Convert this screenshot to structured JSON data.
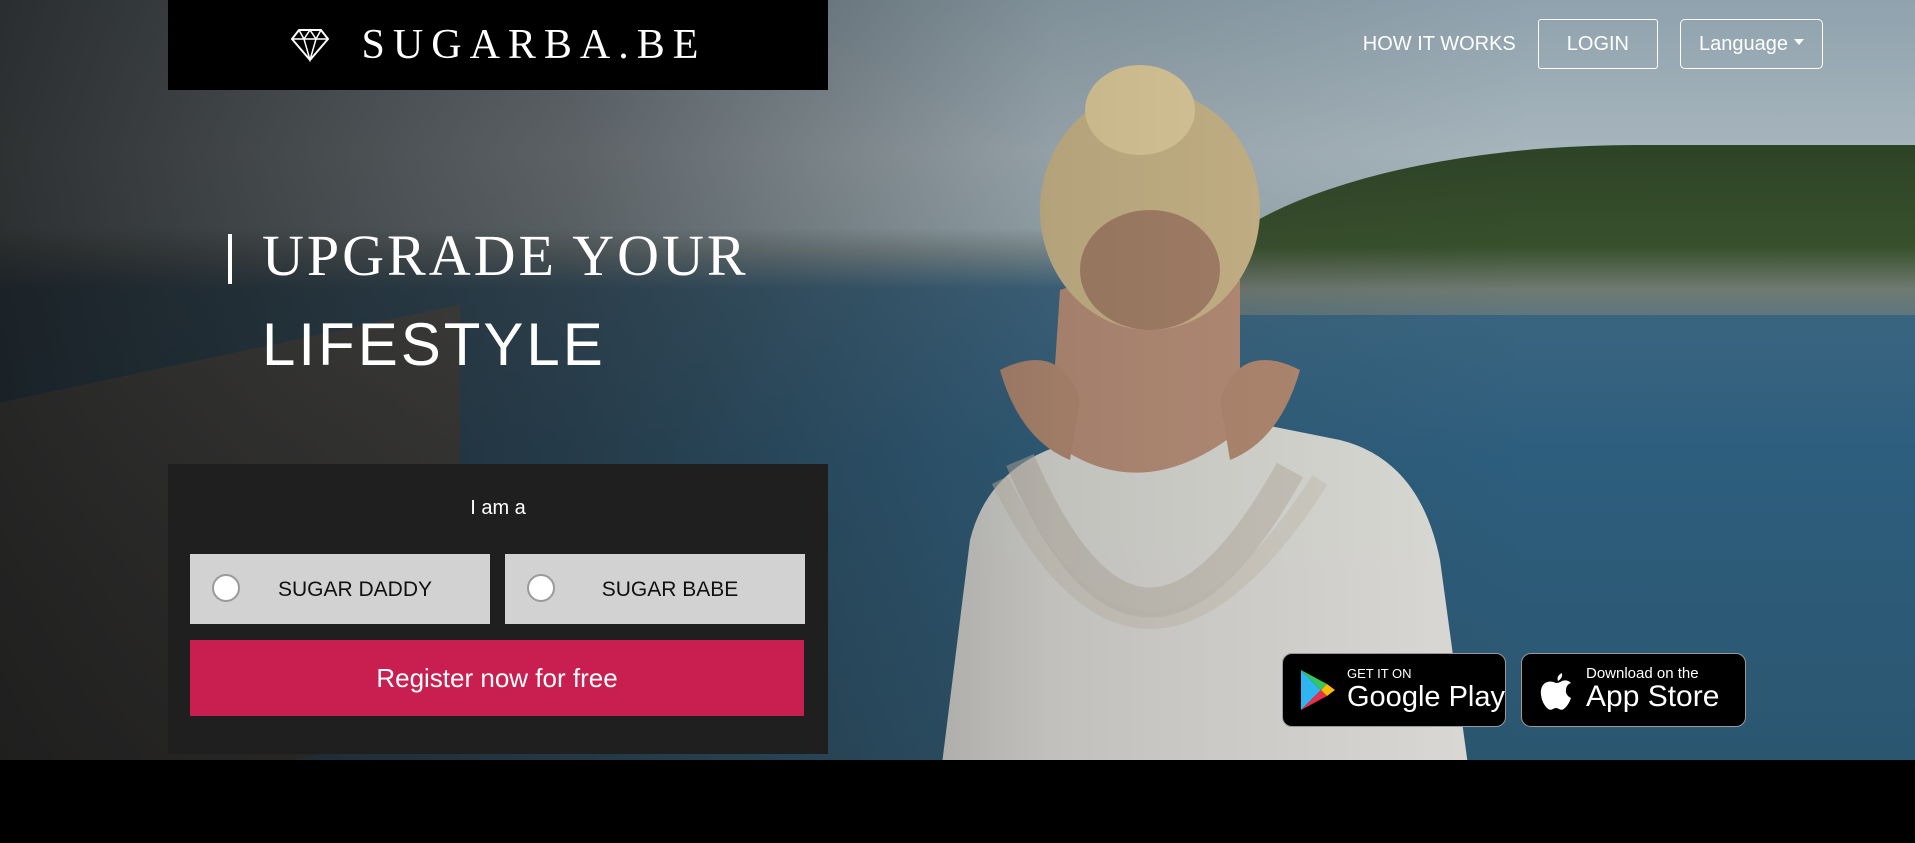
{
  "brand": {
    "name": "SUGARBA.BE",
    "logo_icon": "diamond-icon"
  },
  "nav": {
    "how_it_works": "HOW IT WORKS",
    "login": "LOGIN",
    "language": "Language"
  },
  "hero": {
    "line1": "UPGRADE YOUR",
    "line2": "LIFESTYLE"
  },
  "registration": {
    "prompt": "I am a",
    "options": [
      {
        "label": "SUGAR DADDY"
      },
      {
        "label": "SUGAR BABE"
      }
    ],
    "register_label": "Register now for free"
  },
  "stores": {
    "google": {
      "small": "GET IT ON",
      "big": "Google Play"
    },
    "apple": {
      "small": "Download on the",
      "big": "App Store"
    }
  },
  "colors": {
    "accent": "#c91f50",
    "background": "#000000",
    "panel": "#1f1f1f",
    "option": "#d2d2d2"
  }
}
